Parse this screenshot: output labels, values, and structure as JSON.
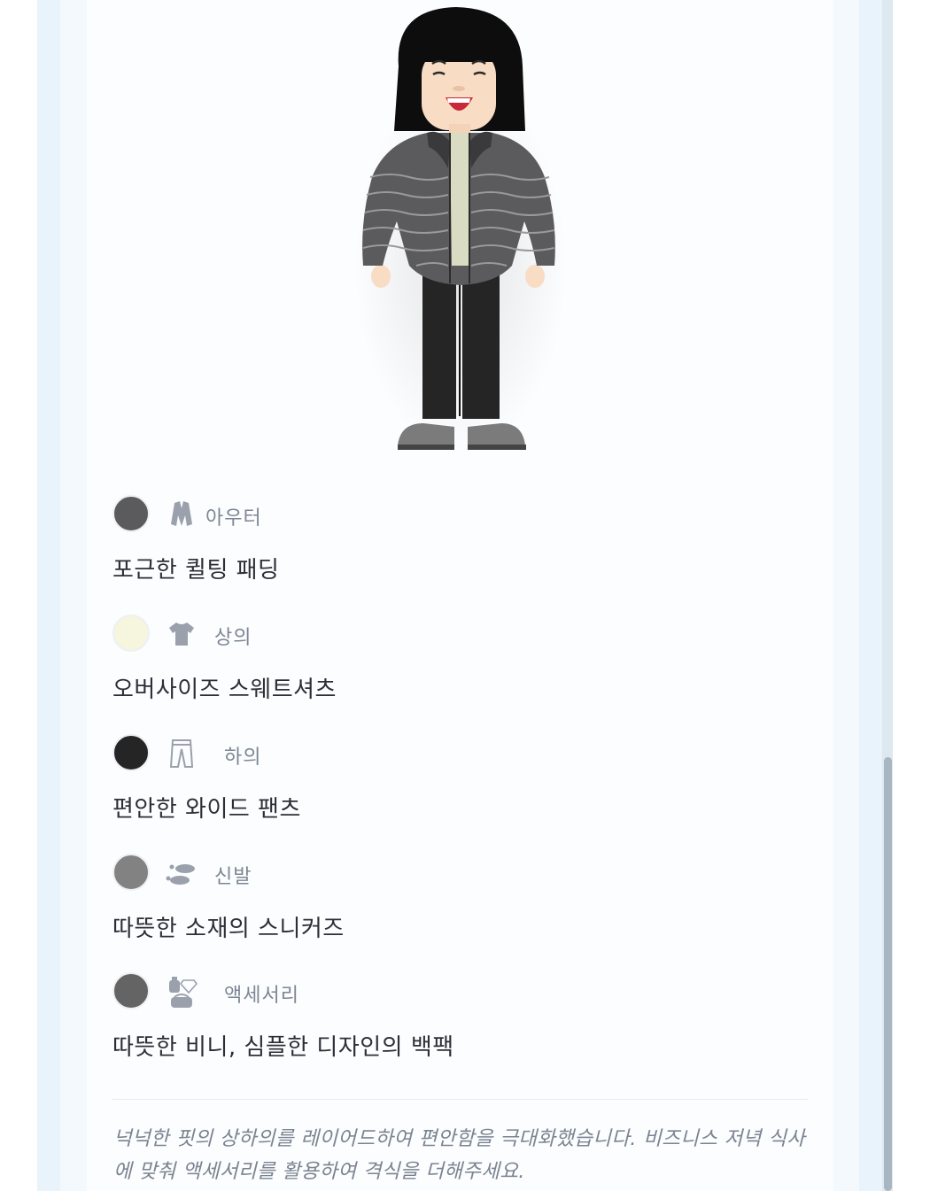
{
  "outfit": {
    "items": [
      {
        "category": "아우터",
        "icon": "jacket-icon",
        "color": "#5b5b5d",
        "description": "포근한 퀼팅 패딩"
      },
      {
        "category": "상의",
        "icon": "tshirt-icon",
        "color": "#f6f5dd",
        "description": "오버사이즈 스웨트셔츠"
      },
      {
        "category": "하의",
        "icon": "pants-icon",
        "color": "#252525",
        "description": "편안한 와이드 팬츠"
      },
      {
        "category": "신발",
        "icon": "footprints-icon",
        "color": "#828282",
        "description": "따뜻한 소재의 스니커즈"
      },
      {
        "category": "액세서리",
        "icon": "accessories-icon",
        "color": "#646464",
        "description": "따뜻한 비니, 심플한 디자인의 백팩"
      }
    ],
    "note": "넉넉한 핏의 상하의를 레이어드하여 편안함을 극대화했습니다. 비즈니스 저녁 식사에 맞춰 액세서리를 활용하여 격식을 더해주세요."
  },
  "colors": {
    "page_background": "#e9f3fc",
    "card_background": "#fcfdfe",
    "text_primary": "#2b2f36",
    "text_muted": "#7c8694",
    "icon_gray": "#9aa1ac"
  }
}
